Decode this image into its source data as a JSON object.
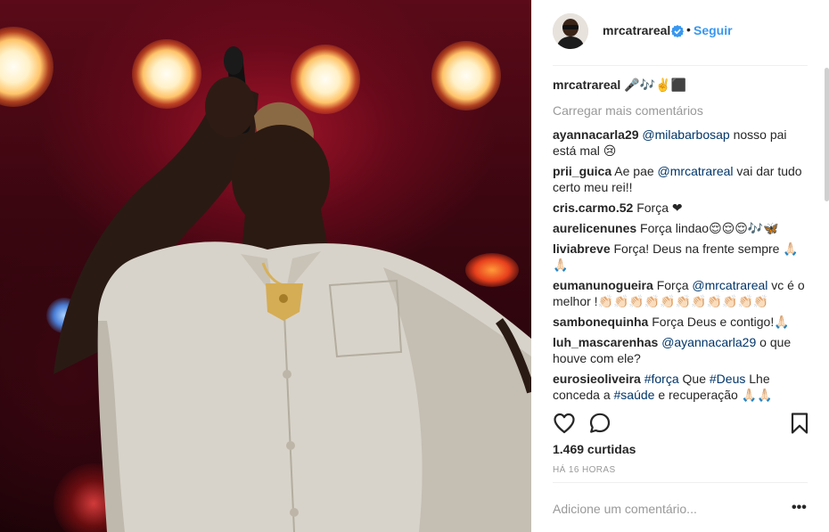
{
  "colors": {
    "accent": "#3897f0",
    "mention": "#003569",
    "muted": "#999999",
    "text": "#262626"
  },
  "photo": {
    "description_icon": "concert-photo"
  },
  "header": {
    "username": "mrcatrareal",
    "verified_icon": "verified-badge-icon",
    "separator": "•",
    "follow_label": "Seguir"
  },
  "caption": {
    "user": "mrcatrareal",
    "text": "🎤🎶✌️⬛"
  },
  "load_more": "Carregar mais comentários",
  "comments": [
    {
      "user": "ayannacarla29",
      "mention": "@milabarbosap",
      "text": " nosso pai está mal 😢"
    },
    {
      "user": "prii_guica",
      "pre": "Ae pae ",
      "mention": "@mrcatrareal",
      "text": " vai dar tudo certo meu rei!!"
    },
    {
      "user": "cris.carmo.52",
      "text": "Força ❤"
    },
    {
      "user": "aurelicenunes",
      "text": "Força lindao😌😌😌🎶🦋"
    },
    {
      "user": "liviabreve",
      "text": "Força! Deus na frente sempre 🙏🏻🙏🏻"
    },
    {
      "user": "eumanunogueira",
      "pre": "Força ",
      "mention": "@mrcatrareal",
      "text": " vc é o melhor !👏🏻👏🏻👏🏻👏🏻👏🏻👏🏻👏🏻👏🏻👏🏻👏🏻👏🏻"
    },
    {
      "user": "sambonequinha",
      "text": "Força Deus e contigo!🙏🏻"
    },
    {
      "user": "luh_mascarenhas",
      "mention": "@ayannacarla29",
      "text": " o que houve com ele?"
    },
    {
      "user": "eurosieoliveira",
      "mention": "#força",
      "pre2": " Que ",
      "mention2": "#Deus",
      "text": " Lhe conceda a ",
      "mention3": "#saúde",
      "text2": " e recuperação 🙏🏻🙏🏻"
    }
  ],
  "actions": {
    "like_icon": "heart-icon",
    "comment_icon": "comment-bubble-icon",
    "save_icon": "bookmark-icon"
  },
  "likes": "1.469 curtidas",
  "time": "HÁ 16 HORAS",
  "add_comment": {
    "placeholder": "Adicione um comentário...",
    "more_label": "•••"
  }
}
